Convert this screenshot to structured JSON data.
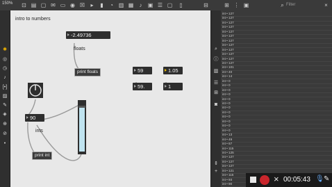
{
  "toolbar": {
    "zoom": "150%",
    "filter_placeholder": "Filter"
  },
  "canvas": {
    "title": "intro to numbers",
    "objects": {
      "flonum_top": "-2.49736",
      "flonum_mid": "1.05",
      "flonum_right": "1",
      "int_59": "59",
      "flonum_59": "59.",
      "int_90": "90"
    },
    "messages": {
      "print_floats": "print floats",
      "print_int": "print int"
    },
    "comments": {
      "floats": "floats",
      "ints": "ints"
    },
    "slider_level": 0.9
  },
  "console": {
    "rows": [
      "int • 127",
      "int • 127",
      "int • 127",
      "int • 127",
      "int • 127",
      "int • 127",
      "int • 127",
      "int • 127",
      "int • 127",
      "int • 127",
      "int • 127",
      "int • 127",
      "int • 101",
      "int • 40",
      "int • 14",
      "int • 0",
      "int • 0",
      "int • 0",
      "int • 0",
      "int • 0",
      "int • 0",
      "int • 0",
      "int • 0",
      "int • 0",
      "int • 0",
      "int • 0",
      "int • 0",
      "int • 13",
      "int • 49",
      "int • 67",
      "int • 115",
      "int • 125",
      "int • 127",
      "int • 127",
      "int • 127",
      "int • 121",
      "int • 115",
      "int • 93",
      "int • 90"
    ]
  },
  "recording": {
    "time": "00:05:43"
  }
}
